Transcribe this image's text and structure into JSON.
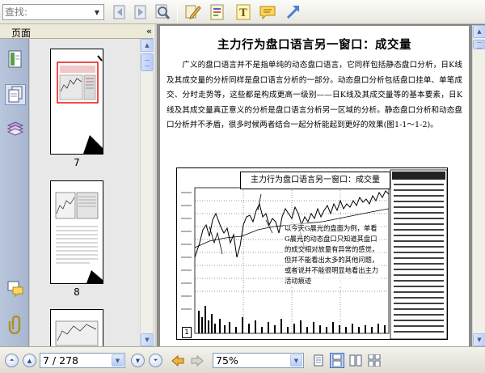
{
  "toolbar": {
    "search_placeholder": "查找:",
    "icons": [
      "prev-result-icon",
      "next-result-icon",
      "search-icon",
      "pen-icon",
      "highlight-note-icon",
      "text-tool-icon",
      "comment-icon",
      "arrow-tool-icon"
    ]
  },
  "sidebar": {
    "title": "页面",
    "collapse": "«",
    "thumbnails": [
      {
        "label": "7"
      },
      {
        "label": "8"
      }
    ]
  },
  "document": {
    "title": "主力行为盘口语言另一窗口：成交量",
    "paragraph": "广义的盘口语言并不是指单纯的动态盘口语言，它同样包括静态盘口分析，日K线及其成交量的分析同样是盘口语言分析的一部分。动态盘口分析包括盘口挂单、单笔成交、分时走势等，这些都是构成更高一级别——日K线及其成交量等的基本要素，日K线及其成交量真正意义的分析是盘口语言分析另一区域的分析。静态盘口分析和动态盘口分析并不矛盾，很多时候两者结合一起分析能起到更好的效果(图1-1～1-2)。",
    "figure_caption": "主力行为盘口语言另一窗口：成交量",
    "figure_note": "以今天G晨光的盘面为例，单看G晨光的动态盘口只知道其盘口的成交相对放量有异常的感觉，但并不能看出太多的其他问题，或者说并不能很明显地看出主力活动痕迹",
    "figure_number": "1"
  },
  "statusbar": {
    "page_value": "7 / 278",
    "zoom_value": "75%"
  },
  "colors": {
    "accent": "#316ac5",
    "rail": "#a7b6cf",
    "doc_bg": "#8c8c8c"
  }
}
